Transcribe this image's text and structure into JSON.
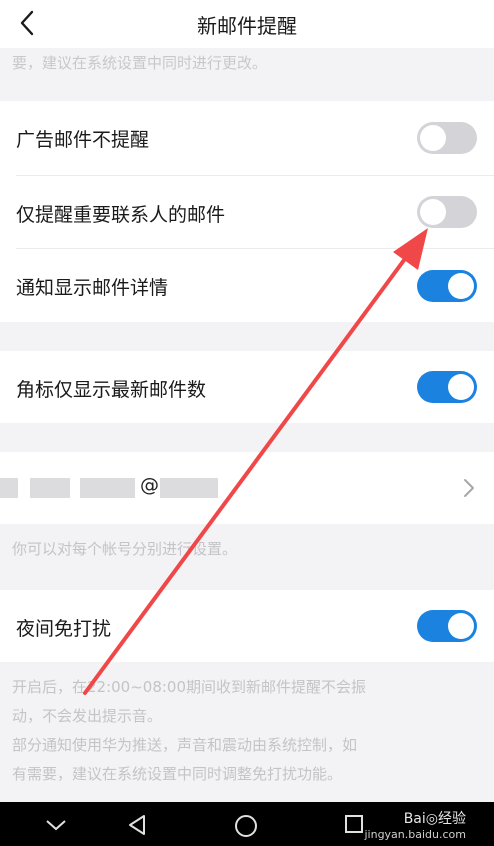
{
  "header": {
    "title": "新邮件提醒"
  },
  "hints": {
    "top_truncated": "要，建议在系统设置中同时进行更改。"
  },
  "group1": {
    "ad_label": "广告邮件不提醒",
    "ad_state": "off",
    "important_label": "仅提醒重要联系人的邮件",
    "important_state": "off",
    "details_label": "通知显示邮件详情",
    "details_state": "on"
  },
  "group2": {
    "badge_label": "角标仅显示最新邮件数",
    "badge_state": "on"
  },
  "account": {
    "email_fragment": "@",
    "note": "你可以对每个帐号分别进行设置。"
  },
  "group4": {
    "night_label": "夜间免打扰",
    "night_state": "on"
  },
  "dnd_note": {
    "line1": "开启后，在22:00~08:00期间收到新邮件提醒不会振",
    "line2": "动，不会发出提示音。",
    "line3": "部分通知使用华为推送，声音和震动由系统控制，如",
    "line4": "有需要，建议在系统设置中同时调整免打扰功能。"
  },
  "watermark": {
    "brand": "Bai◎经验",
    "domain": "jingyan.baidu.com"
  },
  "colors": {
    "toggle_on": "#1b82e0",
    "toggle_off": "#d4d4d8",
    "annotation_arrow": "#f04848"
  }
}
